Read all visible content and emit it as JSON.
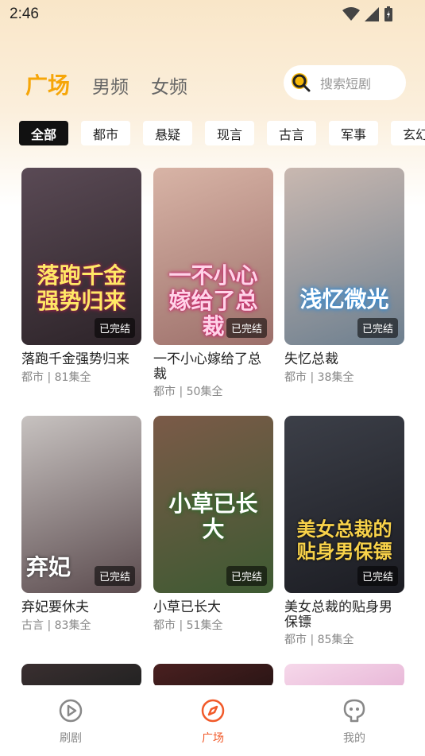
{
  "status": {
    "time": "2:46"
  },
  "tabs": [
    {
      "label": "广场",
      "active": true
    },
    {
      "label": "男频",
      "active": false
    },
    {
      "label": "女频",
      "active": false
    }
  ],
  "search": {
    "placeholder": "搜索短剧"
  },
  "categories": [
    "全部",
    "都市",
    "悬疑",
    "现言",
    "古言",
    "军事",
    "玄幻"
  ],
  "dramas": [
    {
      "title": "落跑千金强势归来",
      "poster_text": "落跑千金强势归来",
      "genre": "都市",
      "episodes": "81集全",
      "status": "已完结",
      "colors": [
        "#5a4a55",
        "#2c2328"
      ]
    },
    {
      "title": "一不小心嫁给了总裁",
      "poster_text": "一不小心嫁给了总裁",
      "genre": "都市",
      "episodes": "50集全",
      "status": "已完结",
      "colors": [
        "#d8b4a6",
        "#9c6f6a"
      ]
    },
    {
      "title": "失忆总裁",
      "poster_text": "浅忆微光",
      "genre": "都市",
      "episodes": "38集全",
      "status": "已完结",
      "colors": [
        "#c9b8b0",
        "#6d7f8f"
      ]
    },
    {
      "title": "弃妃要休夫",
      "poster_text": "弃妃",
      "genre": "古言",
      "episodes": "83集全",
      "status": "已完结",
      "colors": [
        "#c7c2c0",
        "#5b4b4e"
      ]
    },
    {
      "title": "小草已长大",
      "poster_text": "小草已长大",
      "genre": "都市",
      "episodes": "51集全",
      "status": "已完结",
      "colors": [
        "#7b5a48",
        "#3d5a32"
      ]
    },
    {
      "title": "美女总裁的贴身男保镖",
      "poster_text": "美女总裁的贴身男保镖",
      "genre": "都市",
      "episodes": "85集全",
      "status": "已完结",
      "colors": [
        "#3c3f48",
        "#1b1c22"
      ]
    }
  ],
  "nav": [
    {
      "label": "刷剧",
      "icon": "play-circle-icon",
      "active": false
    },
    {
      "label": "广场",
      "icon": "compass-icon",
      "active": true
    },
    {
      "label": "我的",
      "icon": "user-face-icon",
      "active": false
    }
  ],
  "accent": "#f6a609",
  "nav_active_color": "#f15a2a"
}
